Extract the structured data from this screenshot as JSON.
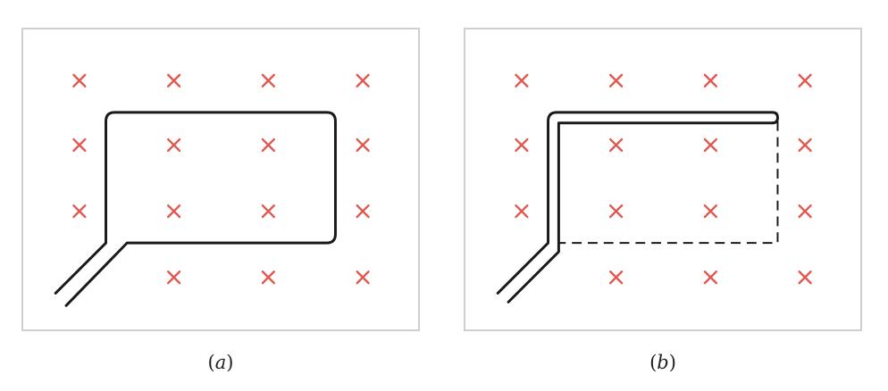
{
  "colors": {
    "field_marker": "#e0584f",
    "wire": "#1a1a1a",
    "frame_border": "#cfcfcf",
    "background": "#ffffff"
  },
  "field": {
    "marker_symbol": "×",
    "direction": "into-page",
    "rows": 4,
    "columns": 4
  },
  "panels": [
    {
      "id": "a",
      "caption_open": "(",
      "caption_letter": "a",
      "caption_close": ")"
    },
    {
      "id": "b",
      "caption_open": "(",
      "caption_letter": "b",
      "caption_close": ")"
    }
  ]
}
